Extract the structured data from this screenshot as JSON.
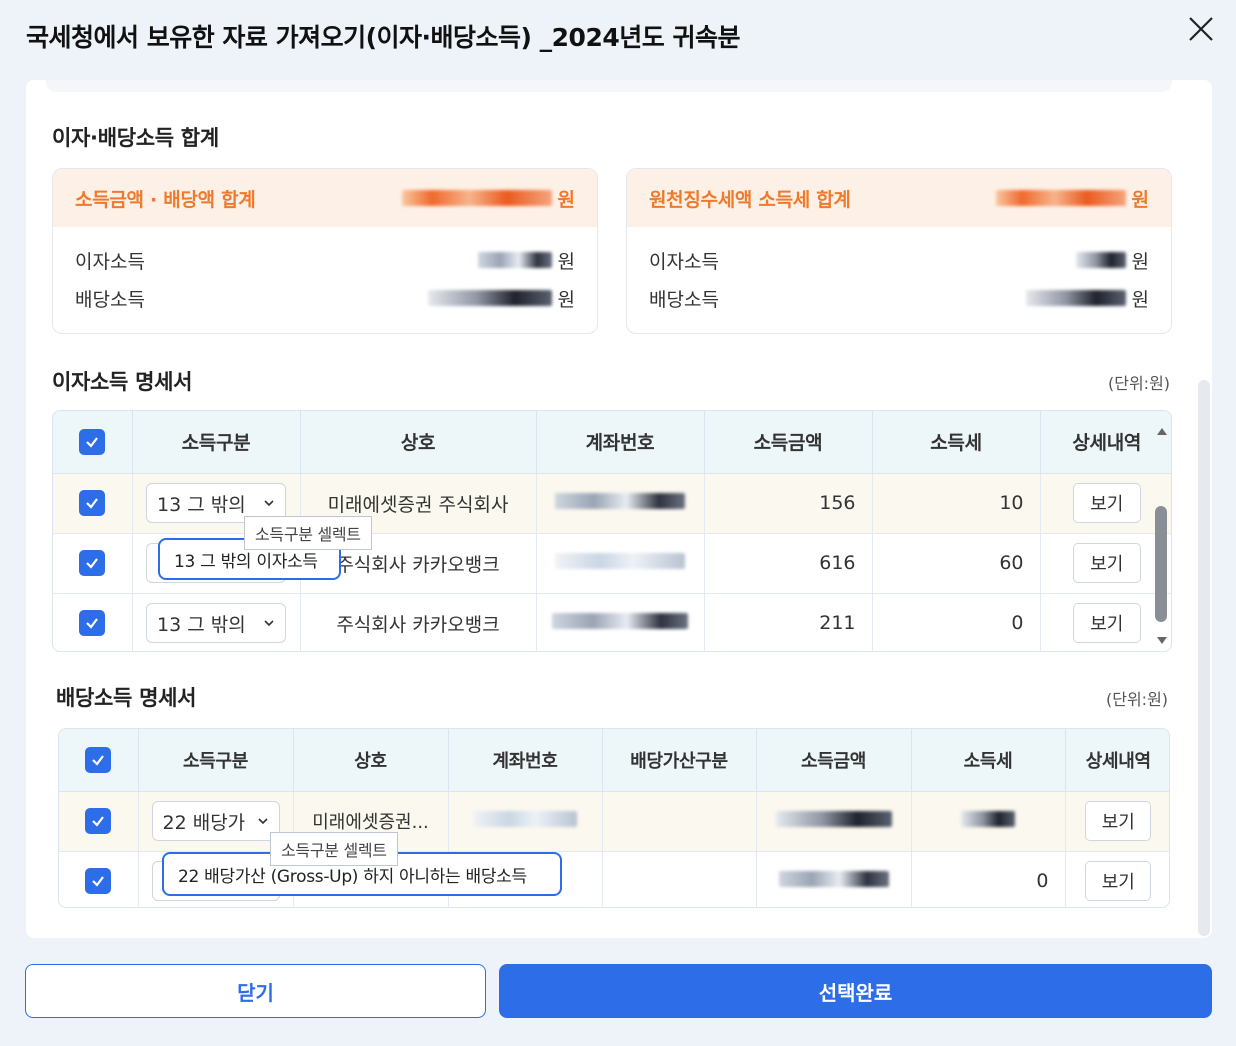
{
  "modal": {
    "title": "국세청에서 보유한 자료 가져오기(이자·배당소득) _2024년도 귀속분"
  },
  "summary": {
    "title": "이자·배당소득 합계",
    "income_box": {
      "header_label": "소득금액 · 배당액 합계",
      "header_unit": "원",
      "rows": [
        {
          "label": "이자소득",
          "unit": "원"
        },
        {
          "label": "배당소득",
          "unit": "원"
        }
      ]
    },
    "tax_box": {
      "header_label": "원천징수세액 소득세 합계",
      "header_unit": "원",
      "rows": [
        {
          "label": "이자소득",
          "unit": "원"
        },
        {
          "label": "배당소득",
          "unit": "원"
        }
      ]
    }
  },
  "interest": {
    "title": "이자소득 명세서",
    "unit": "(단위:원)",
    "columns": [
      "소득구분",
      "상호",
      "계좌번호",
      "소득금액",
      "소득세",
      "상세내역"
    ],
    "rows": [
      {
        "type": "13 그 밖의",
        "company": "미래에셋증권 주식회사",
        "amount": "156",
        "tax": "10",
        "detail": "보기"
      },
      {
        "type": "",
        "company": "주식회사 카카오뱅크",
        "amount": "616",
        "tax": "60",
        "detail": "보기"
      },
      {
        "type": "13 그 밖의",
        "company": "주식회사 카카오뱅크",
        "amount": "211",
        "tax": "0",
        "detail": "보기"
      }
    ],
    "tooltip": "소득구분 셀렉트",
    "dropdown_option": "13 그 밖의 이자소득"
  },
  "dividend": {
    "title": "배당소득 명세서",
    "unit": "(단위:원)",
    "columns": [
      "소득구분",
      "상호",
      "계좌번호",
      "배당가산구분",
      "소득금액",
      "소득세",
      "상세내역"
    ],
    "rows": [
      {
        "type": "22 배당가",
        "company": "미래에셋증권...",
        "extra": "",
        "amount": "",
        "tax": "",
        "detail": "보기"
      },
      {
        "type": "",
        "company": "...",
        "extra": "",
        "amount": "",
        "tax": "0",
        "detail": "보기"
      }
    ],
    "tooltip": "소득구분 셀렉트",
    "dropdown_option": "22 배당가산 (Gross-Up) 하지 아니하는 배당소득"
  },
  "footer": {
    "close_label": "닫기",
    "confirm_label": "선택완료"
  },
  "colors": {
    "accent": "#2d6ee8",
    "summary_header_bg": "#fdf0e6",
    "summary_header_text": "#ef7a2c"
  }
}
